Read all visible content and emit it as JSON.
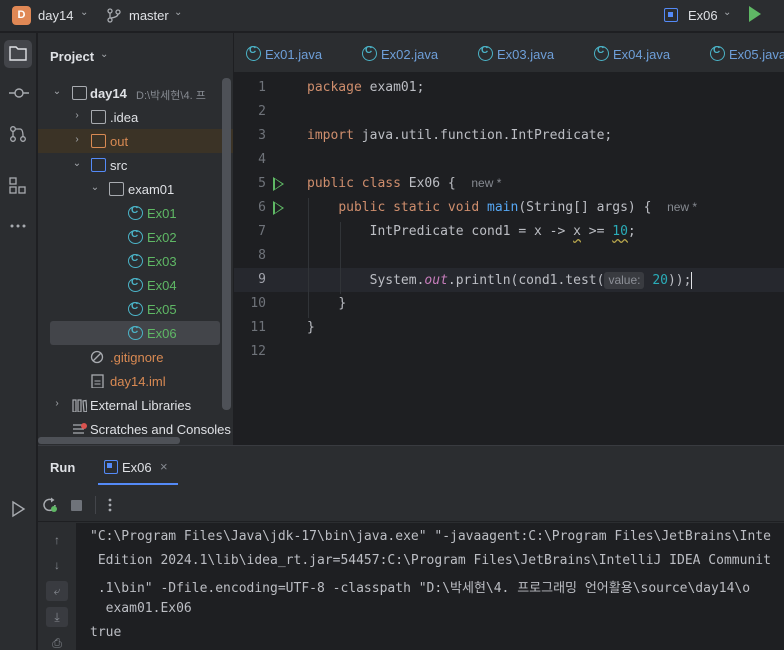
{
  "titlebar": {
    "project_badge": "D",
    "project_name": "day14",
    "branch": "master",
    "run_config": "Ex06"
  },
  "project_panel": {
    "title": "Project",
    "root_name": "day14",
    "root_path": "D:\\박세현\\4. 프",
    "items": [
      {
        "label": ".idea"
      },
      {
        "label": "out"
      },
      {
        "label": "src"
      },
      {
        "label": "exam01"
      },
      {
        "label": "Ex01"
      },
      {
        "label": "Ex02"
      },
      {
        "label": "Ex03"
      },
      {
        "label": "Ex04"
      },
      {
        "label": "Ex05"
      },
      {
        "label": "Ex06"
      },
      {
        "label": ".gitignore"
      },
      {
        "label": "day14.iml"
      },
      {
        "label": "External Libraries"
      },
      {
        "label": "Scratches and Consoles"
      }
    ]
  },
  "tabs": [
    "Ex01.java",
    "Ex02.java",
    "Ex03.java",
    "Ex04.java",
    "Ex05.java"
  ],
  "editor": {
    "line_numbers": [
      "1",
      "2",
      "3",
      "4",
      "5",
      "6",
      "7",
      "8",
      "9",
      "10",
      "11",
      "12"
    ],
    "l1_kw": "package",
    "l1_rest": " exam01;",
    "l3_kw": "import",
    "l3_rest": " java.util.function.IntPredicate;",
    "l5_kw": "public class",
    "l5_rest": " Ex06 {",
    "l5_hint": "new *",
    "l6_kw": "public static void",
    "l6_fn": "main",
    "l6_rest": "(String[] args) {",
    "l6_hint": "new *",
    "l7_a": "IntPredicate cond1 = x -> ",
    "l7_b": "x",
    "l7_c": " >= ",
    "l7_num": "10",
    "l7_d": ";",
    "l9_a": "System.",
    "l9_static": "out",
    "l9_b": ".println(cond1.test(",
    "l9_param": "value:",
    "l9_num": "20",
    "l9_c": "));",
    "l10": "}",
    "l11": "}"
  },
  "run_panel": {
    "title": "Run",
    "tab_label": "Ex06",
    "close": "×",
    "console_lines": [
      "\"C:\\Program Files\\Java\\jdk-17\\bin\\java.exe\" \"-javaagent:C:\\Program Files\\JetBrains\\Inte",
      " Edition 2024.1\\lib\\idea_rt.jar=54457:C:\\Program Files\\JetBrains\\IntelliJ IDEA Communit",
      " .1\\bin\" -Dfile.encoding=UTF-8 -classpath \"D:\\박세현\\4. 프로그래밍 언어활용\\source\\day14\\o",
      "  exam01.Ex06",
      "true"
    ]
  },
  "colors": {
    "keyword": "#cf8e6d",
    "function": "#56a8f5",
    "number": "#2aacb8",
    "accent": "#548af7",
    "run_green": "#5fb865"
  }
}
